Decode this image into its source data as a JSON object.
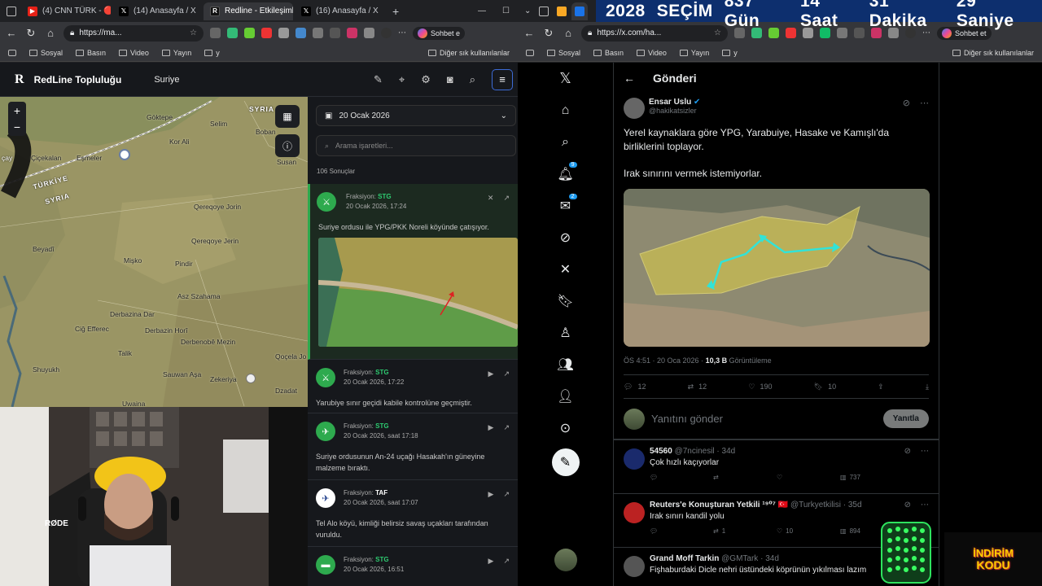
{
  "left_browser": {
    "tabs": [
      {
        "label": "(4) CNN TÜRK - 🔴 C",
        "close": "×"
      },
      {
        "label": "(14) Anasayfa / X",
        "close": "×"
      },
      {
        "label": "Redline - Etkileşimli S",
        "close": "×"
      },
      {
        "label": "(16) Anasayfa / X",
        "close": "×"
      }
    ],
    "new_tab": "+",
    "url": "https://ma...",
    "chat_label": "Sohbet e",
    "bookmarks": [
      "Sosyal",
      "Basın",
      "Video",
      "Yayın",
      "y"
    ],
    "other_bookmarks": "Diğer sık kullanılanlar"
  },
  "right_browser": {
    "url": "https://x.com/ha...",
    "chat_label": "Sohbet et",
    "bookmarks": [
      "Sosyal",
      "Basın",
      "Video",
      "Yayın",
      "y"
    ],
    "other_bookmarks": "Diğer sık kullanılanlar"
  },
  "countdown": {
    "year": "2028",
    "label": "SEÇİM",
    "days": "837 Gün",
    "hours": "14 Saat",
    "minutes": "31 Dakika",
    "seconds": "29 Saniye"
  },
  "redline": {
    "logo": "R",
    "title": "RedLine Topluluğu",
    "country": "Suriye",
    "zoom_in": "+",
    "zoom_out": "−",
    "date": "20 Ocak 2026",
    "search_placeholder": "Arama işaretleri...",
    "results": "106 Sonuçlar",
    "map_labels": [
      "Göktepe",
      "Selim",
      "Boban",
      "SYRIA",
      "Kor Ali",
      "Çiçekalan",
      "Eşmeler",
      "TÜRKİYE",
      "SYRIA",
      "Qereqoye Jorin",
      "Susan",
      "Beyadî",
      "Mişko",
      "Qereqoye Jerin",
      "Pindir",
      "Asz Szahama",
      "Derbazina Dar",
      "Derbazin Horî",
      "Ciğ Efferec",
      "Derbenobê Mezin",
      "Talik",
      "Sauwan Aşa",
      "Zekeriya",
      "Qoçela Jo",
      "Uwaina",
      "Shuyukh",
      "Dzadat",
      "çay",
      "Qereqoye"
    ],
    "events": [
      {
        "faction_label": "Fraksiyon:",
        "faction": "STG",
        "time": "20 Ocak 2026, 17:24",
        "text": "Suriye ordusu ile YPG/PKK Noreli köyünde çatışıyor."
      },
      {
        "faction_label": "Fraksiyon:",
        "faction": "STG",
        "time": "20 Ocak 2026, 17:22",
        "text": "Yarubiye sınır geçidi kabile kontrolüne geçmiştir."
      },
      {
        "faction_label": "Fraksiyon:",
        "faction": "STG",
        "time": "20 Ocak 2026, saat 17:18",
        "text": "Suriye ordusunun An-24 uçağı Hasakah'ın güneyine malzeme bıraktı."
      },
      {
        "faction_label": "Fraksiyon:",
        "faction": "TAF",
        "time": "20 Ocak 2026, saat 17:07",
        "text": "Tel Alo köyü, kimliği belirsiz savaş uçakları tarafından vuruldu."
      },
      {
        "faction_label": "Fraksiyon:",
        "faction": "STG",
        "time": "20 Ocak 2026, 16:51",
        "text": ""
      }
    ]
  },
  "x": {
    "header": "Gönderi",
    "author_name": "Ensar Uslu",
    "author_handle": "@hakikatsizler",
    "body_line1": "Yerel kaynaklara göre YPG, Yarabuiye, Hasake ve Kamışlı'da birliklerini toplayor.",
    "body_line2": "Irak sınırını vermek istemiyorlar.",
    "timestamp": "ÖS 4:51 · 20 Oca 2026 · ",
    "views": "10,3 B",
    "views_label": "Görüntüleme",
    "stats": {
      "replies": "12",
      "reposts": "12",
      "likes": "190",
      "bookmarks": "10"
    },
    "reply_placeholder": "Yanıtını gönder",
    "reply_button": "Yanıtla",
    "nav_badges": {
      "notifications": "9",
      "messages": "2"
    },
    "replies": [
      {
        "name": "54560",
        "handle": "@7ncinesil · 34d",
        "text": "Çok hızlı kaçıyorlar",
        "views": "737"
      },
      {
        "name": "Reuters'e Konuşturan Yetkili ¹⁹⁰⁷ 🇹🇷",
        "handle": "@Turkyetkilisi · 35d",
        "text": "Irak sınırı kandil yolu",
        "reposts": "1",
        "likes": "10",
        "views": "894"
      },
      {
        "name": "Grand Moff Tarkin",
        "handle": "@GMTark · 34d",
        "text": "Fişhaburdaki Dicle nehri üstündeki köprünün yıkılması lazım"
      }
    ]
  },
  "overlay": {
    "logo_line1": "İNDİRİM",
    "logo_line2": "KODU",
    "mic_brand": "RØDE"
  },
  "colors": {
    "accent_blue": "#1d9bf0",
    "redline_green": "#2eaa4e",
    "countdown_bg": "#0d2f6e"
  }
}
